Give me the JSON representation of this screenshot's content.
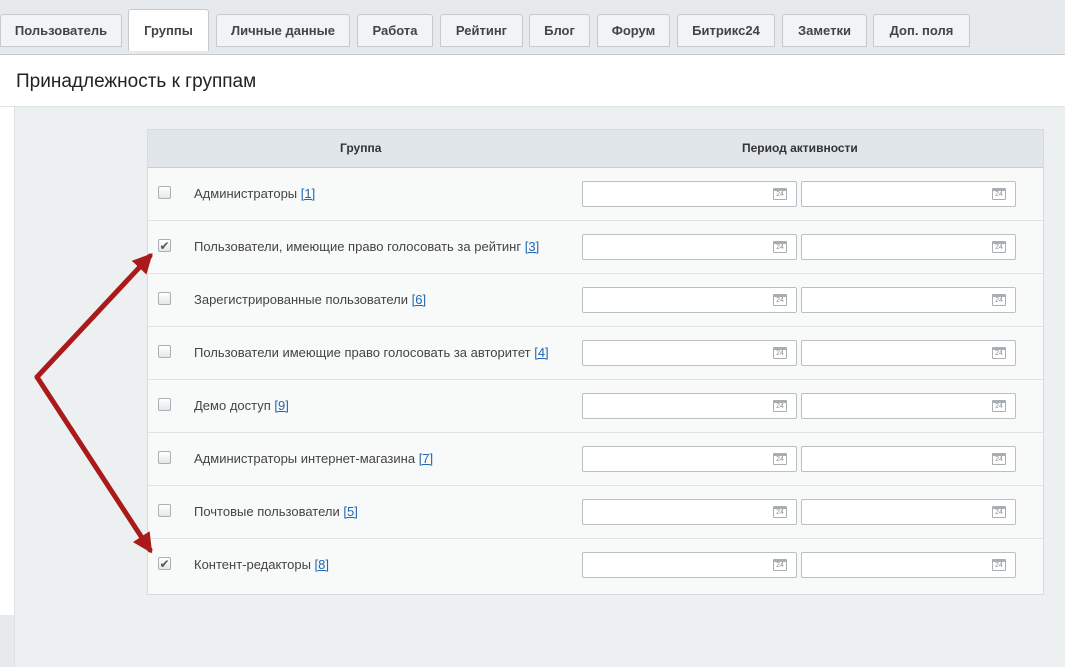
{
  "tabs": [
    {
      "label": "Пользователь",
      "active": false
    },
    {
      "label": "Группы",
      "active": true
    },
    {
      "label": "Личные данные",
      "active": false
    },
    {
      "label": "Работа",
      "active": false
    },
    {
      "label": "Рейтинг",
      "active": false
    },
    {
      "label": "Блог",
      "active": false
    },
    {
      "label": "Форум",
      "active": false
    },
    {
      "label": "Битрикс24",
      "active": false
    },
    {
      "label": "Заметки",
      "active": false
    },
    {
      "label": "Доп. поля",
      "active": false
    }
  ],
  "section_title": "Принадлежность к группам",
  "table": {
    "col_group": "Группа",
    "col_period": "Период активности",
    "calendar_icon_text": "24",
    "rows": [
      {
        "name": "Администраторы",
        "id": "[1]",
        "checked": false,
        "date_from": "",
        "date_to": ""
      },
      {
        "name": "Пользователи, имеющие право голосовать за рейтинг",
        "id": "[3]",
        "checked": true,
        "date_from": "",
        "date_to": ""
      },
      {
        "name": "Зарегистрированные пользователи",
        "id": "[6]",
        "checked": false,
        "date_from": "",
        "date_to": ""
      },
      {
        "name": "Пользователи имеющие право голосовать за авторитет",
        "id": "[4]",
        "checked": false,
        "date_from": "",
        "date_to": ""
      },
      {
        "name": "Демо доступ",
        "id": "[9]",
        "checked": false,
        "date_from": "",
        "date_to": ""
      },
      {
        "name": "Администраторы интернет-магазина",
        "id": "[7]",
        "checked": false,
        "date_from": "",
        "date_to": ""
      },
      {
        "name": "Почтовые пользователи",
        "id": "[5]",
        "checked": false,
        "date_from": "",
        "date_to": ""
      },
      {
        "name": "Контент-редакторы",
        "id": "[8]",
        "checked": true,
        "date_from": "",
        "date_to": ""
      }
    ]
  },
  "colors": {
    "annotation_arrow": "#aa1a1a",
    "link": "#2067b0"
  }
}
